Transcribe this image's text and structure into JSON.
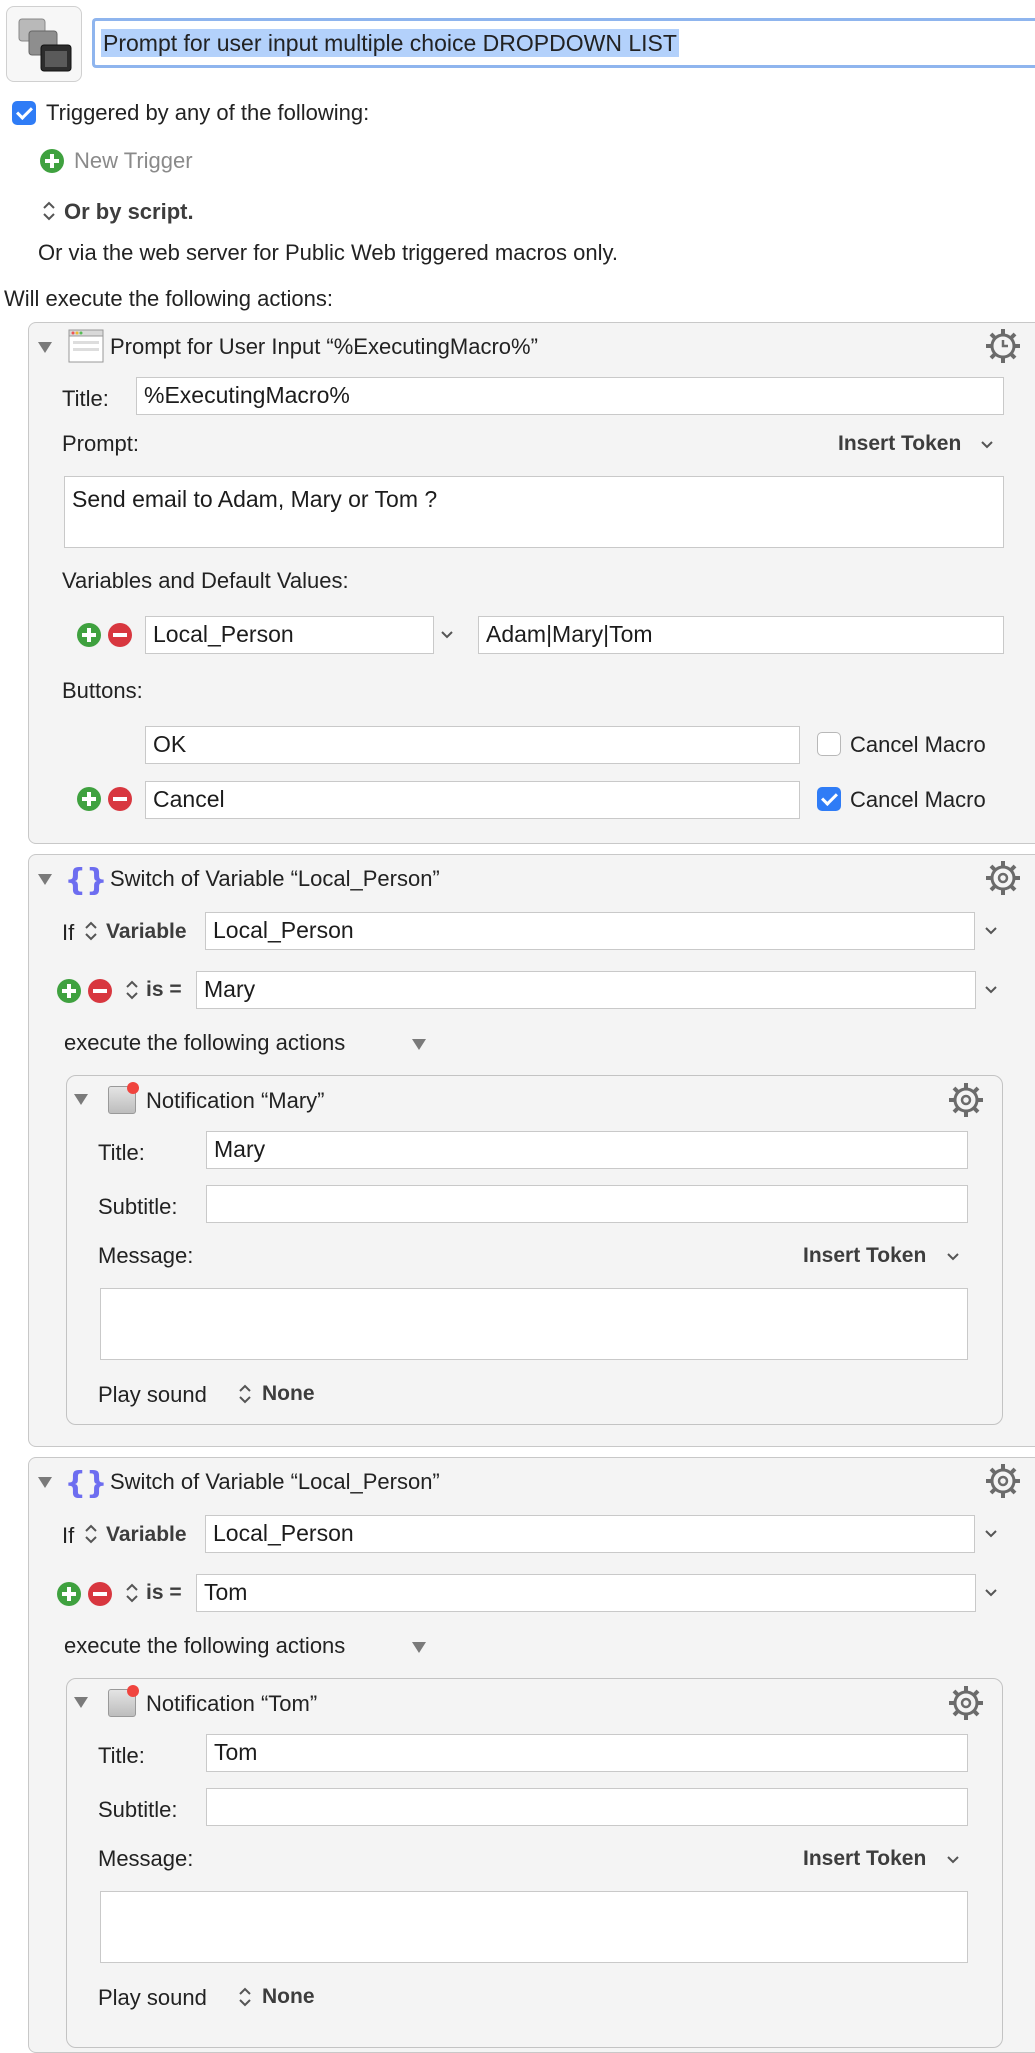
{
  "header": {
    "macro_name": "Prompt for user input multiple choice DROPDOWN LIST",
    "trigger_label": "Triggered by any of the following:",
    "new_trigger": "New Trigger",
    "or_by_script": "Or by script.",
    "web_server_note": "Or via the web server for Public Web triggered macros only.",
    "will_execute": "Will execute the following actions:"
  },
  "prompt_action": {
    "title": "Prompt for User Input “%ExecutingMacro%”",
    "title_label": "Title:",
    "title_value": "%ExecutingMacro%",
    "prompt_label": "Prompt:",
    "insert_token": "Insert Token",
    "prompt_value": "Send email to Adam, Mary or Tom ?",
    "variables_label": "Variables and Default Values:",
    "variable_name": "Local_Person",
    "variable_default": "Adam|Mary|Tom",
    "buttons_label": "Buttons:",
    "buttons": [
      {
        "label": "OK",
        "cancel_label": "Cancel Macro",
        "cancel_checked": false
      },
      {
        "label": "Cancel",
        "cancel_label": "Cancel Macro",
        "cancel_checked": true
      }
    ]
  },
  "switches": [
    {
      "title": "Switch of Variable “Local_Person”",
      "if_label": "If",
      "variable_mode": "Variable",
      "variable": "Local_Person",
      "condition": "is =",
      "value": "Mary",
      "execute_label": "execute the following actions",
      "notification": {
        "title": "Notification “Mary”",
        "title_label": "Title:",
        "title_value": "Mary",
        "subtitle_label": "Subtitle:",
        "subtitle_value": "",
        "message_label": "Message:",
        "insert_token": "Insert Token",
        "message_value": "",
        "play_sound_label": "Play sound",
        "sound": "None"
      }
    },
    {
      "title": "Switch of Variable “Local_Person”",
      "if_label": "If",
      "variable_mode": "Variable",
      "variable": "Local_Person",
      "condition": "is =",
      "value": "Tom",
      "execute_label": "execute the following actions",
      "notification": {
        "title": "Notification “Tom”",
        "title_label": "Title:",
        "title_value": "Tom",
        "subtitle_label": "Subtitle:",
        "subtitle_value": "",
        "message_label": "Message:",
        "insert_token": "Insert Token",
        "message_value": "",
        "play_sound_label": "Play sound",
        "sound": "None"
      }
    }
  ],
  "colors": {
    "accent": "#2f7cf6",
    "selection": "#b3d1fb",
    "add": "#3fa13f",
    "remove": "#d8373f",
    "panel": "#f4f4f4"
  }
}
